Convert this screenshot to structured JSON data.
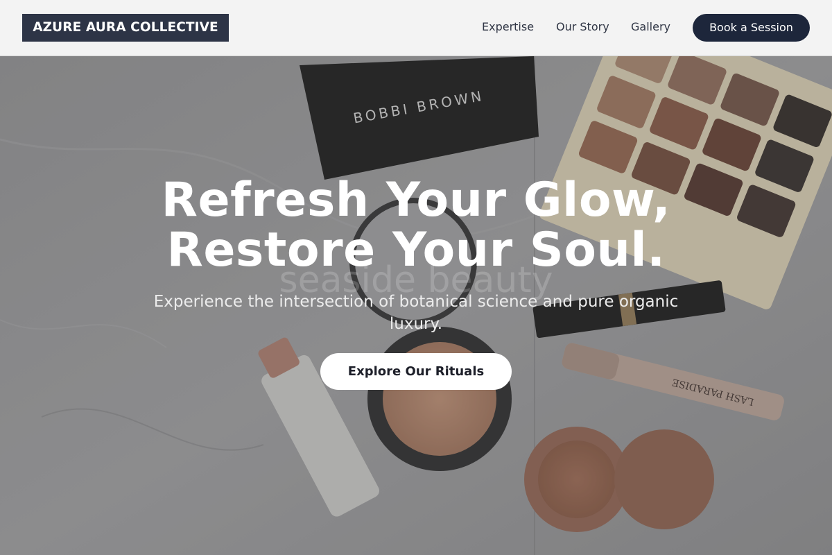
{
  "brand": {
    "name": "AZURE AURA COLLECTIVE"
  },
  "nav": {
    "items": [
      {
        "label": "Expertise"
      },
      {
        "label": "Our Story"
      },
      {
        "label": "Gallery"
      }
    ],
    "cta_label": "Book a Session"
  },
  "hero": {
    "title_line1": "Refresh Your Glow,",
    "title_line2": "Restore Your Soul.",
    "subtitle": "Experience the intersection of botanical science and pure organic luxury.",
    "button_label": "Explore Our Rituals",
    "background": {
      "description_icon": "makeup-flatlay-photo",
      "palette_brand_text": "BOBBI BROWN",
      "mascara_text": "LASH PARADISE",
      "watermark_text": "seaside beauty"
    }
  },
  "colors": {
    "header_bg": "#f3f3f3",
    "logo_bg": "#2d3446",
    "cta_bg": "#1d263b",
    "hero_overlay": "#5e5e5e",
    "button_bg": "#ffffff"
  }
}
